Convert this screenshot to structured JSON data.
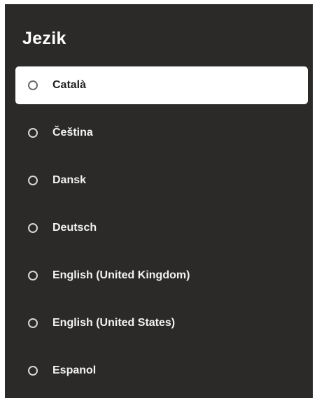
{
  "dialog": {
    "title": "Jezik",
    "options": [
      {
        "label": "Català",
        "selected": false,
        "focused": true
      },
      {
        "label": "Čeština",
        "selected": false,
        "focused": false
      },
      {
        "label": "Dansk",
        "selected": false,
        "focused": false
      },
      {
        "label": "Deutsch",
        "selected": false,
        "focused": false
      },
      {
        "label": "English (United Kingdom)",
        "selected": false,
        "focused": false
      },
      {
        "label": "English (United States)",
        "selected": false,
        "focused": false
      },
      {
        "label": "Espanol",
        "selected": false,
        "focused": false
      }
    ]
  },
  "colors": {
    "panel_background": "#2b2a29",
    "text": "#f2f2f2",
    "focused_background": "#ffffff",
    "focused_text": "#1f1f1f"
  }
}
